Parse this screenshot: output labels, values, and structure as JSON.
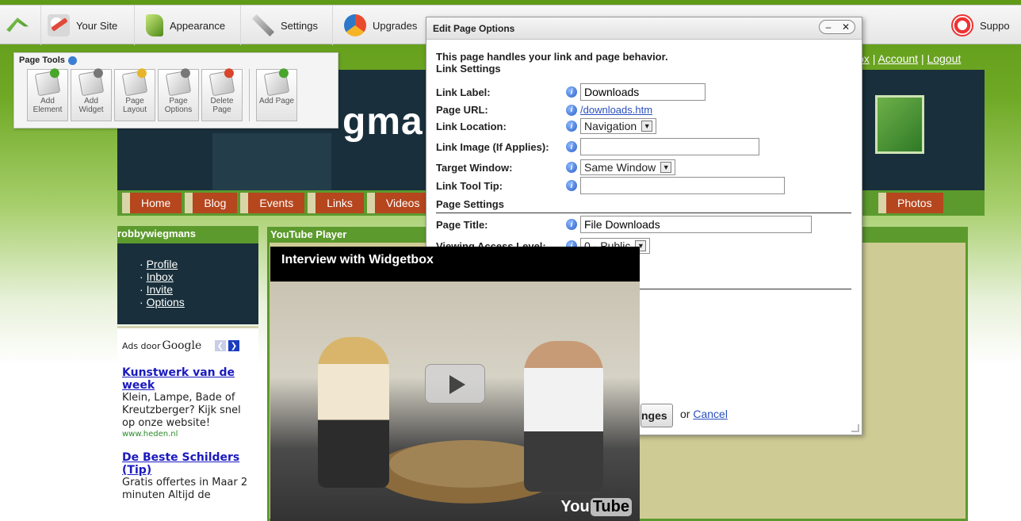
{
  "toolbar": {
    "items": [
      {
        "label": "",
        "icon": "home-arrow-icon"
      },
      {
        "label": "Your Site",
        "icon": "your-site-icon"
      },
      {
        "label": "Appearance",
        "icon": "appearance-icon"
      },
      {
        "label": "Settings",
        "icon": "settings-icon"
      },
      {
        "label": "Upgrades",
        "icon": "upgrades-icon"
      },
      {
        "label": "Suppo",
        "icon": "support-icon"
      }
    ]
  },
  "page_tools": {
    "title": "Page Tools",
    "buttons": [
      {
        "label": "Add Element"
      },
      {
        "label": "Add Widget"
      },
      {
        "label": "Page Layout"
      },
      {
        "label": "Page Options"
      },
      {
        "label": "Delete Page"
      },
      {
        "label": "Add Page"
      }
    ]
  },
  "site": {
    "top_links": {
      "inbox": "ox",
      "account": "Account",
      "logout": "Logout",
      "sep": "|"
    },
    "banner_title": "gman",
    "nav": [
      "Home",
      "Blog",
      "Events",
      "Links",
      "Videos",
      "Photos"
    ],
    "profile": {
      "header": "robbywiegmans",
      "links": [
        "Profile",
        "Inbox",
        "Invite",
        "Options"
      ]
    },
    "ads": {
      "prefix": "Ads door",
      "brand": "Google",
      "items": [
        {
          "title": "Kunstwerk van de week",
          "body": "Klein, Lampe, Bade of Kreutzberger? Kijk snel op onze website!",
          "url": "www.heden.nl"
        },
        {
          "title": "De Beste Schilders (Tip)",
          "body": "Gratis offertes in Maar 2 minuten Altijd de",
          "url": ""
        }
      ]
    },
    "youtube_label": "YouTube Player",
    "video": {
      "title": "Interview with Widgetbox",
      "logo_you": "You",
      "logo_tube": "Tube"
    }
  },
  "dialog": {
    "title": "Edit Page Options",
    "intro": "This page handles your link and page behavior.",
    "link_settings_label": "Link Settings",
    "link_label": {
      "label": "Link Label:",
      "value": "Downloads"
    },
    "page_url": {
      "label": "Page URL:",
      "value": "/downloads.htm"
    },
    "link_location": {
      "label": "Link Location:",
      "value": "Navigation"
    },
    "link_image": {
      "label": "Link Image (If Applies):",
      "value": ""
    },
    "target_window": {
      "label": "Target Window:",
      "value": "Same Window"
    },
    "link_tooltip": {
      "label": "Link Tool Tip:",
      "value": ""
    },
    "page_settings_label": "Page Settings",
    "page_title": {
      "label": "Page Title:",
      "value": "File Downloads"
    },
    "viewing_access": {
      "label": "Viewing Access Level:",
      "value": "0 - Public"
    },
    "save_button": "nges",
    "or_text": "or",
    "cancel_link": "Cancel"
  }
}
